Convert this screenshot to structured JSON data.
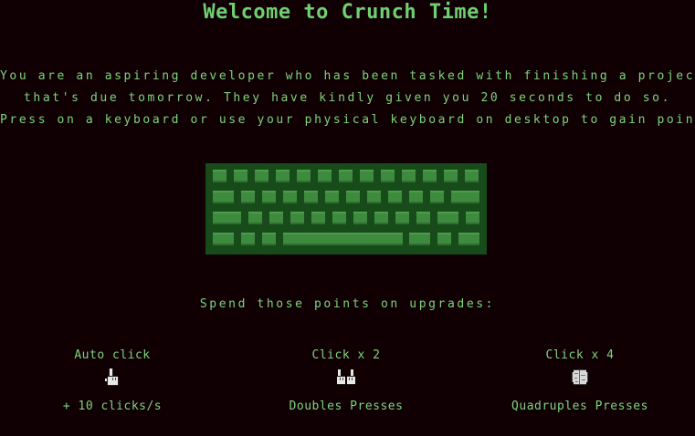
{
  "title": "Welcome to Crunch Time!",
  "intro": {
    "line1": "You are an aspiring developer who has been tasked with finishing a project",
    "line2": "that's due tomorrow. They have kindly given you 20 seconds to do so.",
    "line3": "Press on a keyboard or use your physical keyboard on desktop to gain points."
  },
  "spend_label": "Spend those points on upgrades:",
  "upgrades": [
    {
      "name": "Auto click",
      "icon": "pointing-hand-icon",
      "desc": "+ 10 clicks/s"
    },
    {
      "name": "Click x 2",
      "icon": "two-hands-icon",
      "desc": "Doubles Presses"
    },
    {
      "name": "Click x 4",
      "icon": "brain-icon",
      "desc": "Quadruples Presses"
    }
  ],
  "colors": {
    "background": "#100004",
    "text": "#7fd37a",
    "keyboard_body": "#174b1a",
    "key": "#3e8a3e"
  }
}
